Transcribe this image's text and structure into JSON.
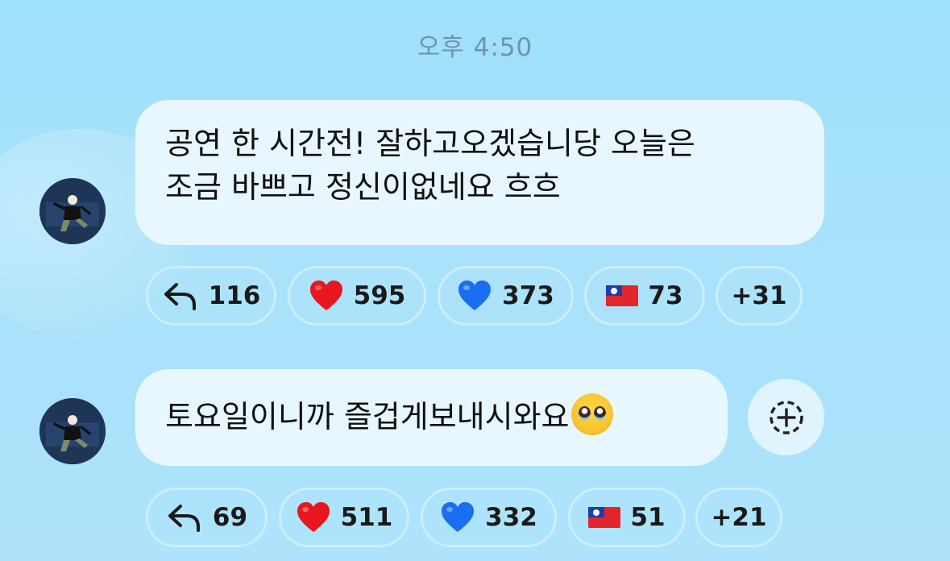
{
  "timestamp": "오후 4:50",
  "messages": [
    {
      "text_line1": "공연 한 시간전! 잘하고오겠습니당 오늘은",
      "text_line2": "조금 바쁘고 정신이없네요 흐흐",
      "reactions": {
        "reply": "116",
        "heart": "595",
        "blue_heart": "373",
        "flag": "73",
        "more": "+31"
      }
    },
    {
      "text": "토요일이니까 즐겁게보내시와요",
      "emoji": "pleading-face",
      "reactions": {
        "reply": "69",
        "heart": "511",
        "blue_heart": "332",
        "flag": "51",
        "more": "+21"
      }
    }
  ],
  "colors": {
    "background": "#a7e2fb",
    "bubble": "#e8f7fe",
    "chip_border": "#cdeefd",
    "timestamp": "#6f95a8"
  }
}
